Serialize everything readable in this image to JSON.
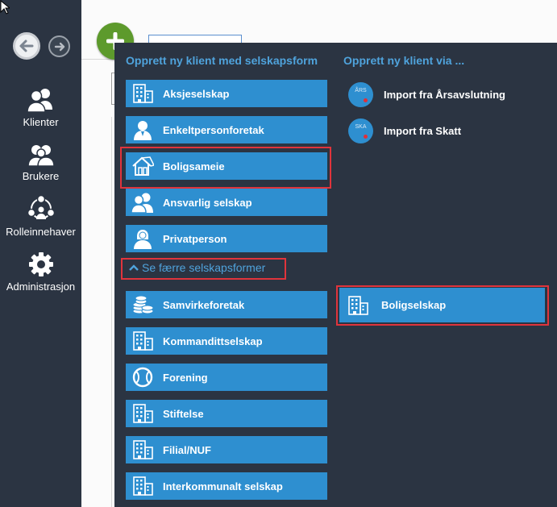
{
  "sidebar": {
    "items": [
      {
        "label": "Klienter",
        "icon": "users-icon"
      },
      {
        "label": "Brukere",
        "icon": "user-group-icon"
      },
      {
        "label": "Rolleinnehaver",
        "icon": "network-people-icon"
      },
      {
        "label": "Administrasjon",
        "icon": "gear-icon"
      }
    ]
  },
  "panel": {
    "heading_left": "Opprett ny klient med selskapsform",
    "heading_right": "Opprett ny klient via ...",
    "company_forms": [
      {
        "label": "Aksjeselskap",
        "icon": "building-icon"
      },
      {
        "label": "Enkeltpersonforetak",
        "icon": "person-icon"
      },
      {
        "label": "Boligsameie",
        "icon": "house-icon"
      },
      {
        "label": "Ansvarlig selskap",
        "icon": "partners-icon"
      },
      {
        "label": "Privatperson",
        "icon": "person-female-icon"
      }
    ],
    "toggle_label": "Se færre selskapsformer",
    "more_forms": [
      {
        "label": "Samvirkeforetak",
        "icon": "coins-icon"
      },
      {
        "label": "Kommandittselskap",
        "icon": "building-icon"
      },
      {
        "label": "Forening",
        "icon": "ball-icon"
      },
      {
        "label": "Stiftelse",
        "icon": "building-icon"
      },
      {
        "label": "Filial/NUF",
        "icon": "building-icon"
      },
      {
        "label": "Interkommunalt selskap",
        "icon": "building-icon"
      }
    ],
    "imports": [
      {
        "label": "Import fra Årsavslutning",
        "badge": "ÅRS"
      },
      {
        "label": "Import fra Skatt",
        "badge": "SKA"
      }
    ],
    "extra_form": {
      "label": "Boligselskap",
      "icon": "building-icon"
    }
  },
  "colors": {
    "sidebar_bg": "#2b3442",
    "button_blue": "#2e8fd0",
    "heading_blue": "#4fa3dc",
    "highlight_red": "#e0343c",
    "add_green": "#5d9a2c"
  }
}
